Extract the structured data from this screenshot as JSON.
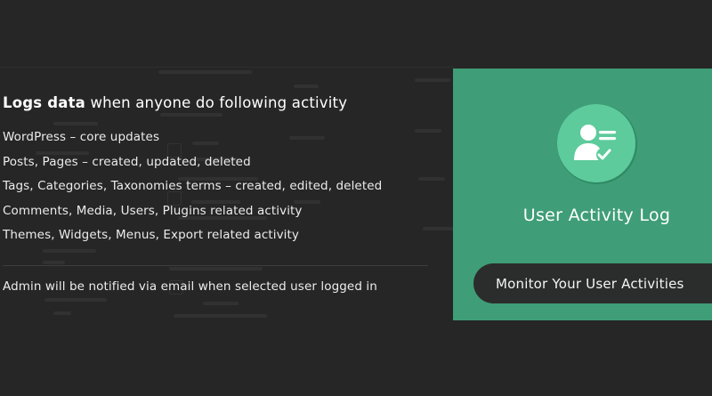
{
  "features": {
    "heading_bold": "Logs data",
    "heading_rest": " when anyone do following activity",
    "items": [
      "WordPress – core updates",
      "Posts, Pages – created, updated, deleted",
      "Tags, Categories, Taxonomies terms – created, edited, deleted",
      "Comments, Media, Users, Plugins related activity",
      "Themes, Widgets, Menus, Export related activity"
    ],
    "notice": "Admin will be notified via email when selected user logged in"
  },
  "promo": {
    "icon": "user-checklist-icon",
    "title": "User Activity Log",
    "button_label": "Monitor Your User Activities",
    "accent_color": "#3f9e77",
    "icon_color": "#5dcb9b"
  }
}
